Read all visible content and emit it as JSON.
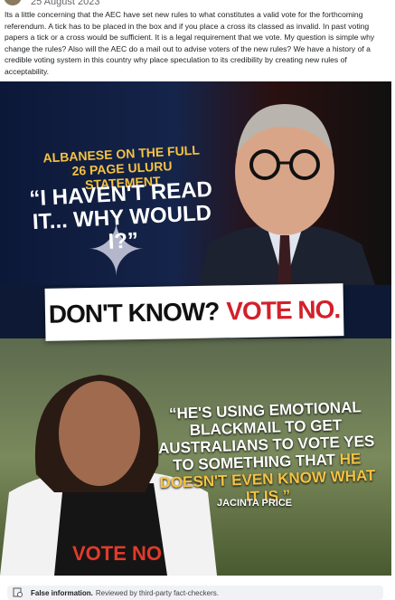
{
  "post": {
    "date": "25 August 2023",
    "text": "Its a little concerning that the AEC have set new rules to what constitutes a valid vote for the forthcoming referendum. A tick has to be placed in the box and if you place a cross its classed as invalid. In past voting papers a tick or a cross would be sufficient. It is a legal requirement that we vote. My question is simple why change the rules? Also will the AEC  do a mail out to advise voters of the new rules?  We have a history of a credible voting system in this country why place speculation to its credibility by creating new rules of acceptability."
  },
  "image": {
    "headline": "ALBANESE ON THE FULL 26 PAGE ULURU STATEMENT",
    "quote1": "“I HAVEN'T READ IT... WHY WOULD I?”",
    "banner_a": "DON'T KNOW?",
    "banner_b": "VOTE NO.",
    "quote2_a": "“HE'S USING EMOTIONAL BLACKMAIL TO GET AUSTRALIANS TO VOTE YES TO SOMETHING THAT ",
    "quote2_b": "HE DOESN'T EVEN KNOW WHAT IT IS.”",
    "attribution": "JACINTA PRICE",
    "shirt": "VOTE NO"
  },
  "fact_check": {
    "label": "False information.",
    "detail": "Reviewed by third-party fact-checkers."
  },
  "colors": {
    "accent_yellow": "#f5c242",
    "red": "#d3202a"
  }
}
